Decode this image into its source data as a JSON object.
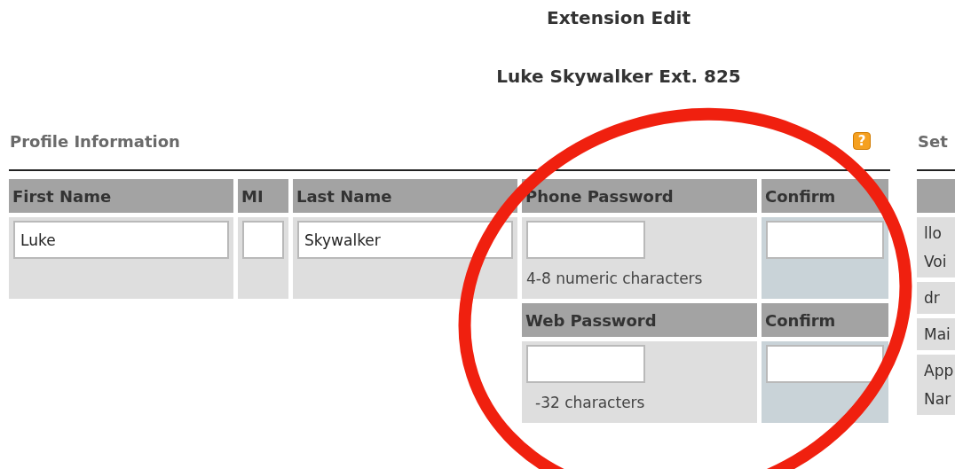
{
  "page": {
    "title": "Extension Edit",
    "subtitle": "Luke Skywalker Ext. 825"
  },
  "profile": {
    "heading": "Profile Information",
    "help": "?",
    "fields": [
      {
        "label": "First Name",
        "value": "Luke"
      },
      {
        "label": "MI"
      },
      {
        "label": "Last Name",
        "value": "Skywalker"
      }
    ],
    "passwords": [
      {
        "label": "Phone Password",
        "hint": "4-8 numeric characters",
        "confirm_label": "Confirm"
      },
      {
        "label": "Web Password",
        "hint": "-32 characters",
        "confirm_label": "Confirm"
      }
    ]
  },
  "settings": {
    "heading": "Set",
    "rows": [
      {
        "lines": [
          "llo",
          "Voi"
        ]
      },
      {
        "lines": [
          "dr"
        ]
      },
      {
        "lines": [
          "Mai"
        ]
      },
      {
        "lines": [
          "App",
          "Nar"
        ]
      }
    ]
  },
  "annotations": [
    {
      "kind": "ellipse"
    }
  ]
}
